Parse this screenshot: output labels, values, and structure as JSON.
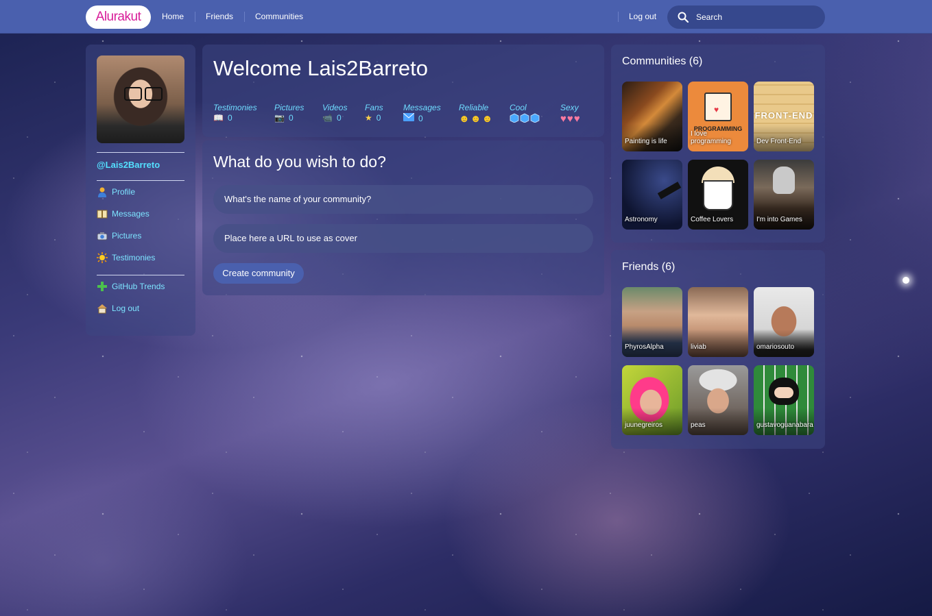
{
  "app": {
    "logo": "Alurakut"
  },
  "topbar": {
    "nav": [
      "Home",
      "Friends",
      "Communities"
    ],
    "logout": "Log out",
    "search_placeholder": "Search"
  },
  "profile": {
    "username": "@Lais2Barreto",
    "menu": [
      {
        "label": "Profile",
        "icon": "user-icon"
      },
      {
        "label": "Messages",
        "icon": "book-icon"
      },
      {
        "label": "Pictures",
        "icon": "camera-icon"
      },
      {
        "label": "Testimonies",
        "icon": "sun-icon"
      }
    ],
    "menu_bottom": [
      {
        "label": "GitHub Trends",
        "icon": "plus-icon"
      },
      {
        "label": "Log out",
        "icon": "home-icon"
      }
    ]
  },
  "welcome": {
    "title": "Welcome Lais2Barreto",
    "stats": [
      {
        "label": "Testimonies",
        "value": "0",
        "icon": "book-icon"
      },
      {
        "label": "Pictures",
        "value": "0",
        "icon": "camera-icon"
      },
      {
        "label": "Videos",
        "value": "0",
        "icon": "video-icon"
      },
      {
        "label": "Fans",
        "value": "0",
        "icon": "star-icon"
      },
      {
        "label": "Messages",
        "value": "0",
        "icon": "mail-icon"
      },
      {
        "label": "Reliable",
        "rating": 3,
        "icon": "smiley-icon"
      },
      {
        "label": "Cool",
        "rating": 3,
        "icon": "ice-cube-icon"
      },
      {
        "label": "Sexy",
        "rating": 3,
        "icon": "heart-icon"
      }
    ]
  },
  "create": {
    "title": "What do you wish to do?",
    "name_placeholder": "What's the name of your community?",
    "url_placeholder": "Place here a URL to use as cover",
    "button": "Create community"
  },
  "communities": {
    "title": "Communities (6)",
    "items": [
      {
        "name": "Painting is life",
        "banner": ""
      },
      {
        "name": "I love programming",
        "banner": "PROGRAMMING"
      },
      {
        "name": "Dev Front-End",
        "banner": "FRONT-END"
      },
      {
        "name": "Astronomy",
        "banner": ""
      },
      {
        "name": "Coffee Lovers",
        "banner": ""
      },
      {
        "name": "I'm into Games",
        "banner": ""
      }
    ]
  },
  "friends": {
    "title": "Friends (6)",
    "items": [
      "PhyrosAlpha",
      "liviab",
      "omariosouto",
      "juunegreiros",
      "peas",
      "gustavoguanabara"
    ]
  },
  "colors": {
    "topbar": "#4a60ae",
    "logo_text": "#d81d99",
    "link": "#7de4ff",
    "username": "#54e0ff"
  }
}
